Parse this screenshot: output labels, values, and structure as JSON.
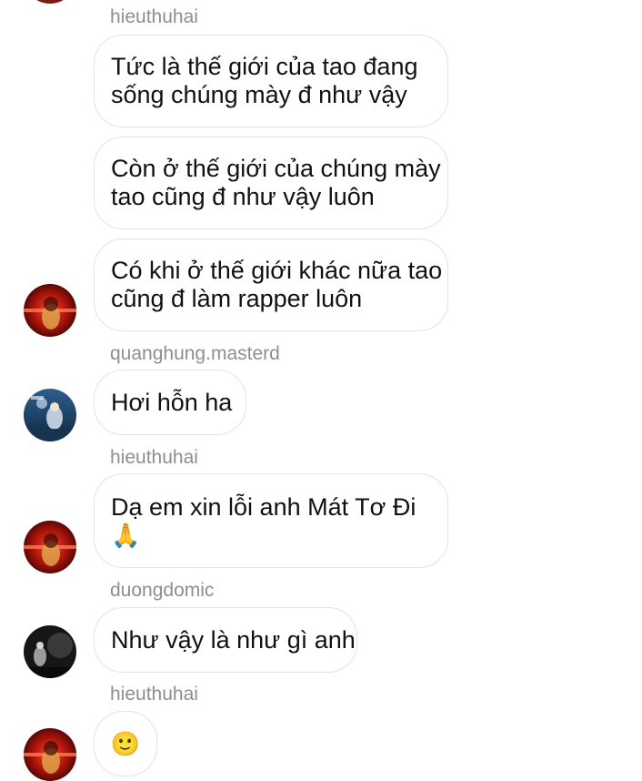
{
  "thread": {
    "messages": [
      {
        "user": "hieuthuhai",
        "lines": [
          "Tức là thế giới của tao đang",
          "sống chúng mày đ như vậy"
        ]
      },
      {
        "user": "",
        "lines": [
          "Còn ở thế giới của chúng mày",
          "tao cũng đ như vậy luôn"
        ]
      },
      {
        "user": "",
        "lines": [
          "Có khi ở thế giới khác nữa tao",
          "cũng đ làm rapper luôn"
        ]
      },
      {
        "user": "quanghung.masterd",
        "lines": [
          "Hơi hỗn ha"
        ]
      },
      {
        "user": "hieuthuhai",
        "lines": [
          "Dạ em xin lỗi anh Mát Tơ Đi",
          "🙏"
        ]
      },
      {
        "user": "duongdomic",
        "lines": [
          "Như vậy là như gì anh"
        ]
      },
      {
        "user": "hieuthuhai",
        "lines": [
          "🙂"
        ]
      }
    ]
  },
  "colors": {
    "username": "#8e8e8e",
    "bubble_border": "#e3e3e3",
    "text": "#111111"
  },
  "icons": {
    "reaction_pray": "folded-hands-emoji",
    "reaction_smile": "slightly-smiling-emoji"
  }
}
